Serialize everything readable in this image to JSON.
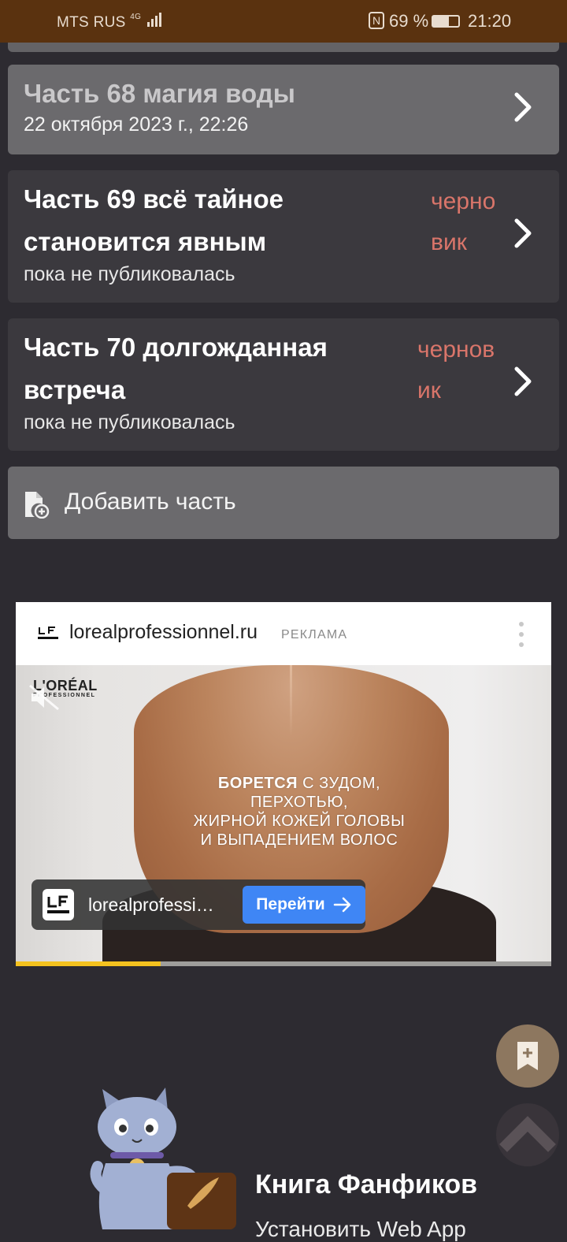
{
  "statusbar": {
    "carrier": "MTS RUS",
    "network": "4G",
    "battery": "69 %",
    "time": "21:20"
  },
  "chapters": [
    {
      "title": "Часть 68 магия воды",
      "subtitle": "22 октября 2023 г., 22:26",
      "status": ""
    },
    {
      "title": "Часть 69 всё тайное становится явным",
      "subtitle": "пока не публиковалась",
      "status": "черновик"
    },
    {
      "title": "Часть 70 долгожданная встреча",
      "subtitle": "пока не публиковалась",
      "status": "черновик"
    }
  ],
  "add_part": {
    "label": "Добавить часть"
  },
  "ad": {
    "domain": "lorealprofessionnel.ru",
    "tag": "РЕКЛАМА",
    "brand": "L'ORÉAL",
    "brand_sub": "PROFESSIONNEL",
    "headline_bold": "БОРЕТСЯ",
    "headline_rest": " С ЗУДОМ,",
    "headline_line2": "ПЕРХОТЬЮ,",
    "headline_line3": "ЖИРНОЙ КОЖЕЙ ГОЛОВЫ",
    "headline_line4": "И ВЫПАДЕНИЕМ ВОЛОС",
    "bar_text": "lorealprofessi…",
    "cta": "Перейти",
    "progress": 0.27
  },
  "promo": {
    "title": "Книга Фанфиков",
    "subtitle": "Установить Web App"
  },
  "colors": {
    "statusbar": "#5a320f",
    "card": "#3b393e",
    "card_active": "#6b6a6d",
    "draft": "#d9756a",
    "cta": "#3f86f5",
    "fab": "#8d775f"
  }
}
